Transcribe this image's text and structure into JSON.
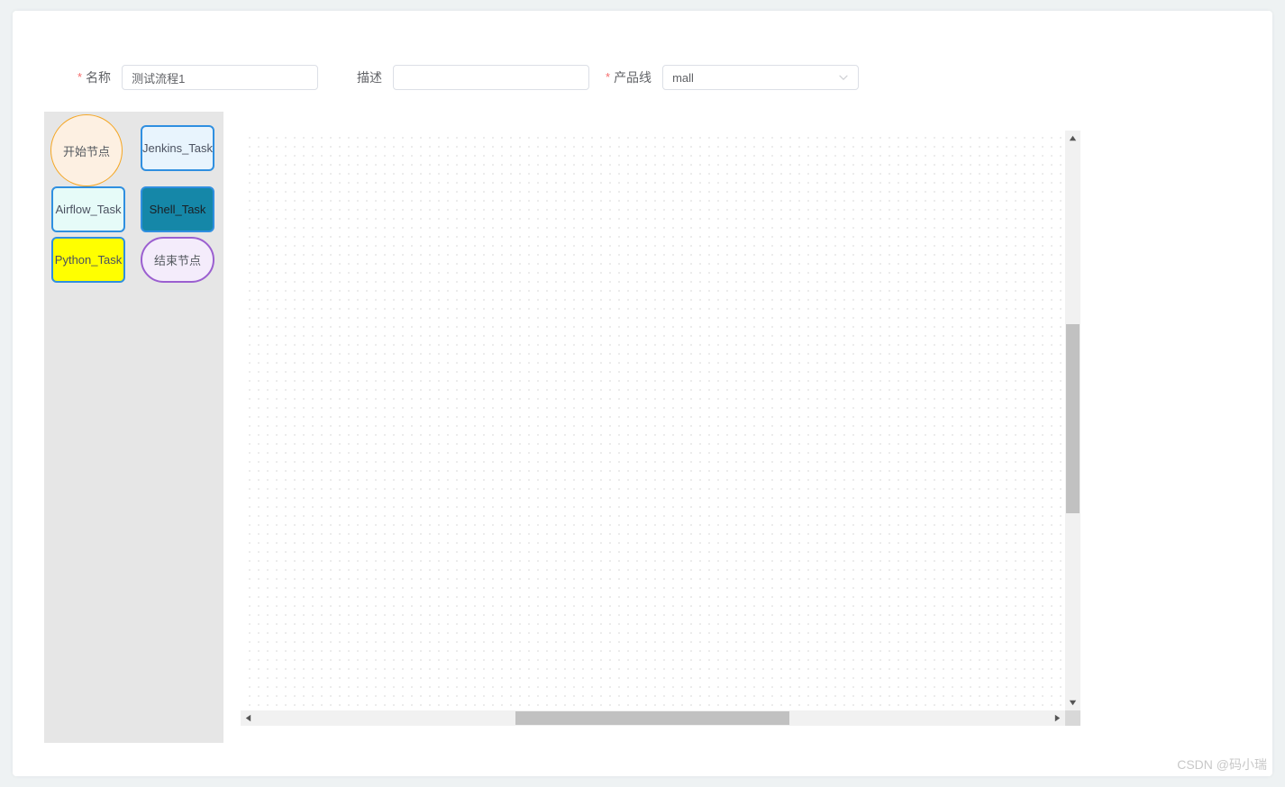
{
  "form": {
    "name": {
      "label": "名称",
      "required_marker": "*",
      "value": "测试流程1",
      "placeholder": ""
    },
    "description": {
      "label": "描述",
      "required_marker": "",
      "value": "",
      "placeholder": ""
    },
    "product_line": {
      "label": "产品线",
      "required_marker": "*",
      "value": "mall",
      "options": [
        "mall"
      ],
      "chevron_icon": "chevron-down-icon"
    }
  },
  "palette": {
    "nodes": [
      {
        "id": "start",
        "label": "开始节点",
        "shape": "circle",
        "fill": "#fdf0e2",
        "stroke": "#f5a623",
        "text_color": "#555a60"
      },
      {
        "id": "jenkins",
        "label": "Jenkins_Task",
        "shape": "rounded-rect",
        "fill": "#e8f4fd",
        "stroke": "#2f8fe0",
        "text_color": "#4a5160"
      },
      {
        "id": "airflow",
        "label": "Airflow_Task",
        "shape": "rounded-rect",
        "fill": "#e6fbf8",
        "stroke": "#2f8fe0",
        "text_color": "#4a5160"
      },
      {
        "id": "shell",
        "label": "Shell_Task",
        "shape": "rounded-rect",
        "fill": "#1587a8",
        "stroke": "#2f8fe0",
        "text_color": "#1b1f24"
      },
      {
        "id": "python",
        "label": "Python_Task",
        "shape": "rounded-rect",
        "fill": "#ffff00",
        "stroke": "#2f8fe0",
        "text_color": "#4a5160"
      },
      {
        "id": "end",
        "label": "结束节点",
        "shape": "stadium",
        "fill": "#f4ecfb",
        "stroke": "#9b5fd0",
        "text_color": "#555a60"
      }
    ]
  },
  "canvas": {
    "grid": "dotted",
    "grid_spacing_px": 10,
    "background": "#ffffff",
    "dot_color": "#bdbdbd"
  },
  "scrollbars": {
    "vertical": {
      "up_icon": "triangle-up-icon",
      "down_icon": "triangle-down-icon",
      "thumb_color": "#c1c1c1",
      "track_color": "#f1f1f1"
    },
    "horizontal": {
      "left_icon": "triangle-left-icon",
      "right_icon": "triangle-right-icon",
      "thumb_color": "#c1c1c1",
      "track_color": "#f1f1f1"
    }
  },
  "watermark": {
    "text": "CSDN @码小瑞"
  }
}
